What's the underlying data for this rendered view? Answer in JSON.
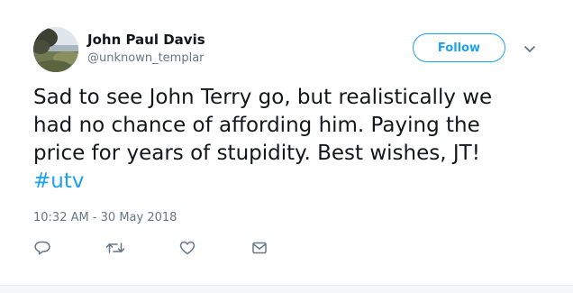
{
  "author": {
    "name": "John Paul Davis",
    "handle": "@unknown_templar"
  },
  "follow_label": "Follow",
  "tweet": {
    "line1": "Sad to see John Terry go, but realistically we",
    "line2": "had no chance of affording him. Paying the",
    "line3": "price for years of stupidity. Best wishes, JT!",
    "hashtag": "#utv"
  },
  "timestamp": "10:32 AM - 30 May 2018",
  "icons": {
    "reply": "reply-icon",
    "retweet": "retweet-icon",
    "like": "like-icon",
    "message": "direct-message-icon",
    "caret": "chevron-down-icon"
  },
  "colors": {
    "accent": "#1da1f2",
    "text": "#14171a",
    "secondary": "#657786"
  }
}
